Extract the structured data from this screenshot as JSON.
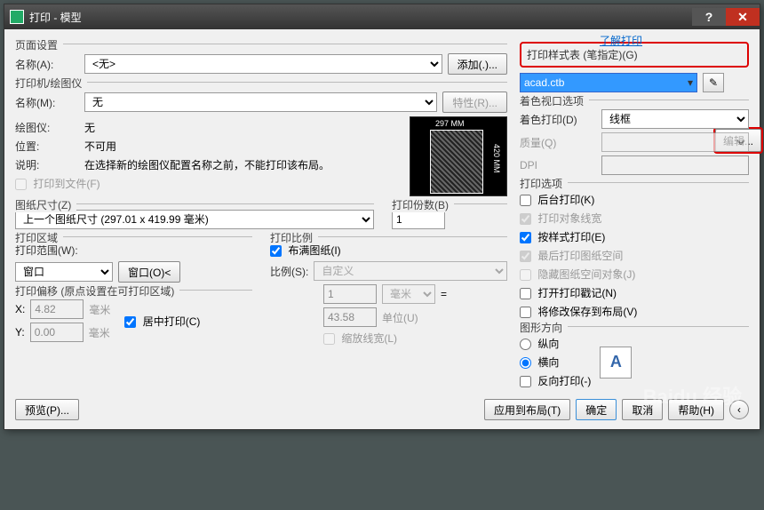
{
  "window_title": "打印 - 模型",
  "link_learn": "了解打印",
  "page_setup": {
    "title": "页面设置",
    "name_label": "名称(A):",
    "name_value": "<无>",
    "add_button": "添加(.)..."
  },
  "printer": {
    "title": "打印机/绘图仪",
    "name_label": "名称(M):",
    "name_value": "无",
    "properties_button": "特性(R)...",
    "plotter_label": "绘图仪:",
    "plotter_value": "无",
    "location_label": "位置:",
    "location_value": "不可用",
    "desc_label": "说明:",
    "desc_value": "在选择新的绘图仪配置名称之前，不能打印该布局。",
    "to_file": "打印到文件(F)",
    "preview_top": "297 MM",
    "preview_side": "420 MM"
  },
  "paper": {
    "title": "图纸尺寸(Z)",
    "value": "上一个图纸尺寸 (297.01 x 419.99 毫米)"
  },
  "copies": {
    "title": "打印份数(B)",
    "value": "1"
  },
  "area": {
    "title": "打印区域",
    "range_label": "打印范围(W):",
    "range_value": "窗口",
    "window_button": "窗口(O)<"
  },
  "scale": {
    "title": "打印比例",
    "fit": "布满图纸(I)",
    "ratio_label": "比例(S):",
    "ratio_value": "自定义",
    "unit_n": "1",
    "unit_mm": "毫米",
    "unit_d": "43.58",
    "unit_u": "单位(U)",
    "scale_lw": "缩放线宽(L)"
  },
  "offset": {
    "title": "打印偏移 (原点设置在可打印区域)",
    "x_label": "X:",
    "x_value": "4.82",
    "x_unit": "毫米",
    "y_label": "Y:",
    "y_value": "0.00",
    "y_unit": "毫米",
    "center": "居中打印(C)"
  },
  "style_table": {
    "title": "打印样式表 (笔指定)(G)",
    "value": "acad.ctb",
    "edit": "编辑..."
  },
  "shaded": {
    "title": "着色视口选项",
    "shade_label": "着色打印(D)",
    "shade_value": "线框",
    "quality_label": "质量(Q)",
    "dpi_label": "DPI"
  },
  "options": {
    "title": "打印选项",
    "bg": "后台打印(K)",
    "lw": "打印对象线宽",
    "style": "按样式打印(E)",
    "last": "最后打印图纸空间",
    "hide": "隐藏图纸空间对象(J)",
    "stamp": "打开打印戳记(N)",
    "save": "将修改保存到布局(V)"
  },
  "orient": {
    "title": "图形方向",
    "portrait": "纵向",
    "landscape": "横向",
    "upside": "反向打印(-)"
  },
  "footer": {
    "preview": "预览(P)...",
    "apply": "应用到布局(T)",
    "ok": "确定",
    "cancel": "取消",
    "help": "帮助(H)"
  },
  "watermark": "Baidu 经验"
}
